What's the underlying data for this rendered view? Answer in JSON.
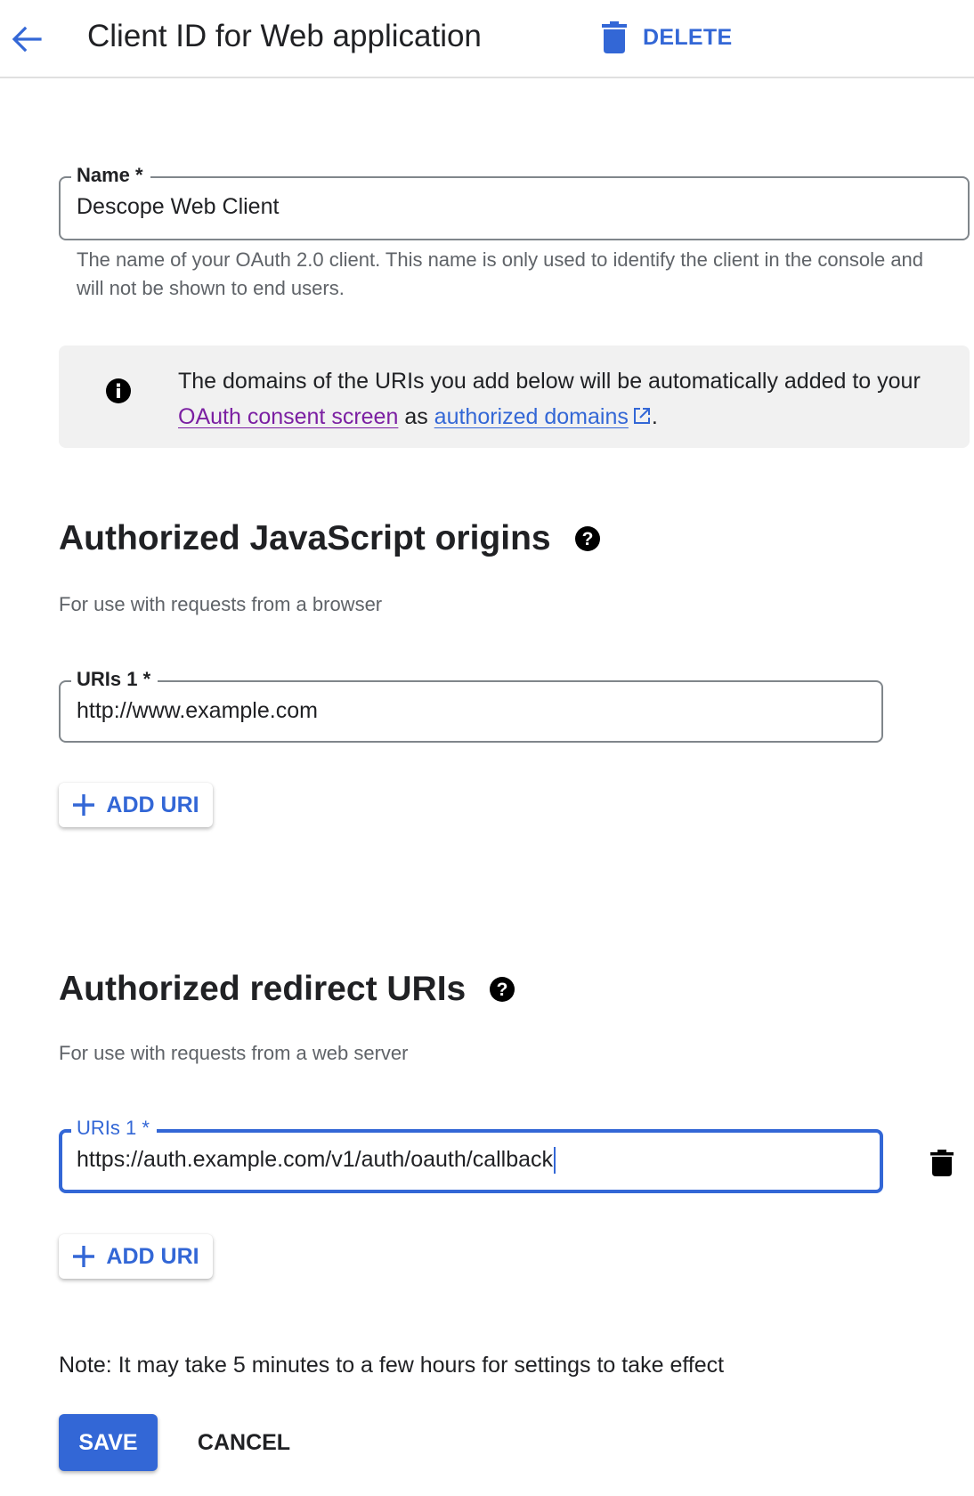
{
  "header": {
    "title": "Client ID for Web application",
    "back_icon": "arrow-left-icon",
    "delete_label": "DELETE",
    "delete_icon": "trash-icon"
  },
  "name_field": {
    "label": "Name *",
    "value": "Descope Web Client",
    "helper": "The name of your OAuth 2.0 client. This name is only used to identify the client in the console and will not be shown to end users."
  },
  "info_banner": {
    "icon": "info-icon",
    "text_before": "The domains of the URIs you add below will be automatically added to your ",
    "link1": "OAuth consent screen",
    "text_middle": " as ",
    "link2": "authorized domains",
    "link2_icon": "external-link-icon",
    "text_after": "."
  },
  "js_origins": {
    "title": "Authorized JavaScript origins",
    "help_icon": "help-icon",
    "subtitle": "For use with requests from a browser",
    "uris": [
      {
        "label": "URIs 1 *",
        "value": "http://www.example.com"
      }
    ],
    "add_label": "ADD URI"
  },
  "redirect_uris": {
    "title": "Authorized redirect URIs",
    "help_icon": "help-icon",
    "subtitle": "For use with requests from a web server",
    "uris": [
      {
        "label": "URIs 1 *",
        "value": "https://auth.example.com/v1/auth/oauth/callback",
        "focused": true
      }
    ],
    "add_label": "ADD URI"
  },
  "note": "Note: It may take 5 minutes to a few hours for settings to take effect",
  "actions": {
    "save_label": "SAVE",
    "cancel_label": "CANCEL"
  },
  "colors": {
    "accent": "#3367d6",
    "visited_link": "#7b1fa2",
    "banner_bg": "#f1f1f1"
  }
}
